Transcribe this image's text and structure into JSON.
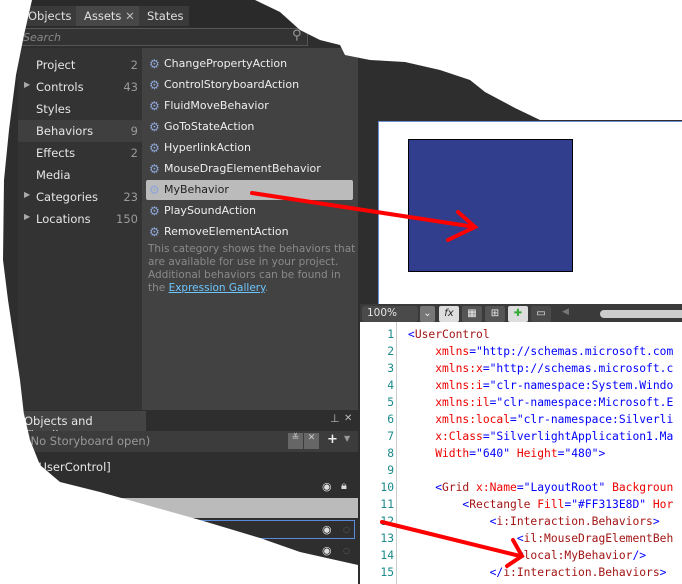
{
  "assets_panel": {
    "tabs": [
      "Objects",
      "Assets",
      "States"
    ],
    "search_placeholder": "Search",
    "categories": [
      {
        "label": "Project",
        "count": "2",
        "expandable": false
      },
      {
        "label": "Controls",
        "count": "43",
        "expandable": true
      },
      {
        "label": "Styles",
        "count": "",
        "expandable": false
      },
      {
        "label": "Behaviors",
        "count": "9",
        "expandable": false,
        "selected": true
      },
      {
        "label": "Effects",
        "count": "2",
        "expandable": false
      },
      {
        "label": "Media",
        "count": "",
        "expandable": false
      },
      {
        "label": "Categories",
        "count": "23",
        "expandable": true
      },
      {
        "label": "Locations",
        "count": "150",
        "expandable": true
      }
    ],
    "items": [
      "ChangePropertyAction",
      "ControlStoryboardAction",
      "FluidMoveBehavior",
      "GoToStateAction",
      "HyperlinkAction",
      "MouseDragElementBehavior",
      "MyBehavior",
      "PlaySoundAction",
      "RemoveElementAction"
    ],
    "selected_item": "MyBehavior",
    "description": "This category shows the behaviors that are available for use in your project. Additional behaviors can be found in the",
    "link": "Expression Gallery",
    "period": "."
  },
  "timeline": {
    "title": "Objects and Timeline",
    "storyboard": "(No Storyboard open)",
    "root": "[UserControl]"
  },
  "design": {
    "zoom": "100%",
    "rect_color": "#313E8D"
  },
  "code": {
    "lines": [
      [
        [
          "b",
          "<"
        ],
        [
          "m",
          "UserControl"
        ]
      ],
      [
        [
          "r",
          "    xmlns"
        ],
        [
          "b",
          "=\"http://schemas.microsoft.com"
        ]
      ],
      [
        [
          "r",
          "    xmlns:x"
        ],
        [
          "b",
          "=\"http://schemas.microsoft.c"
        ]
      ],
      [
        [
          "r",
          "    xmlns:i"
        ],
        [
          "b",
          "=\"clr-namespace:System.Windo"
        ]
      ],
      [
        [
          "r",
          "    xmlns:il"
        ],
        [
          "b",
          "=\"clr-namespace:Microsoft.E"
        ]
      ],
      [
        [
          "r",
          "    xmlns:local"
        ],
        [
          "b",
          "=\"clr-namespace:Silverli"
        ]
      ],
      [
        [
          "r",
          "    x:Class"
        ],
        [
          "b",
          "=\"SilverlightApplication1.Ma"
        ]
      ],
      [
        [
          "r",
          "    Width"
        ],
        [
          "b",
          "=\"640\" "
        ],
        [
          "r",
          "Height"
        ],
        [
          "b",
          "=\"480\">"
        ]
      ],
      [],
      [
        [
          "b",
          "    <"
        ],
        [
          "m",
          "Grid "
        ],
        [
          "r",
          "x:Name"
        ],
        [
          "b",
          "=\"LayoutRoot\" "
        ],
        [
          "r",
          "Backgroun"
        ]
      ],
      [
        [
          "b",
          "        <"
        ],
        [
          "m",
          "Rectangle "
        ],
        [
          "r",
          "Fill"
        ],
        [
          "b",
          "=\"#FF313E8D\" "
        ],
        [
          "r",
          "Hor"
        ]
      ],
      [
        [
          "b",
          "            <"
        ],
        [
          "m",
          "i:Interaction.Behaviors"
        ],
        [
          "b",
          ">"
        ]
      ],
      [
        [
          "b",
          "                <"
        ],
        [
          "m",
          "il:MouseDragElementBeh"
        ]
      ],
      [
        [
          "b",
          "                <"
        ],
        [
          "m",
          "local:MyBehavior"
        ],
        [
          "b",
          "/>"
        ]
      ],
      [
        [
          "b",
          "            </"
        ],
        [
          "m",
          "i:Interaction.Behaviors"
        ],
        [
          "b",
          ">"
        ]
      ]
    ]
  }
}
